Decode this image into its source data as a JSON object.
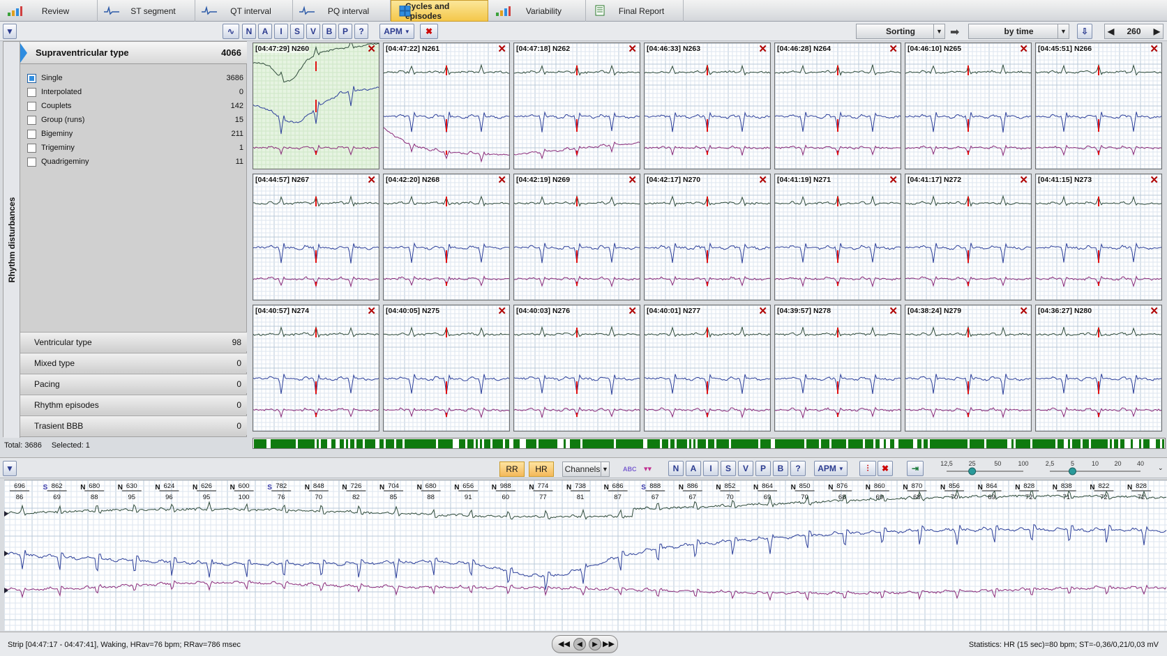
{
  "tabs": [
    {
      "label": "Review",
      "icon": "bar-chart-icon",
      "active": false
    },
    {
      "label": "ST segment",
      "icon": "wave-icon",
      "active": false
    },
    {
      "label": "QT interval",
      "icon": "wave-icon",
      "active": false
    },
    {
      "label": "PQ interval",
      "icon": "wave-icon",
      "active": false
    },
    {
      "label": "Cycles and episodes",
      "icon": "grid-icon",
      "active": true
    },
    {
      "label": "Variability",
      "icon": "bar-chart-icon",
      "active": false
    },
    {
      "label": "Final Report",
      "icon": "document-icon",
      "active": false
    }
  ],
  "toolbar": {
    "class_buttons": [
      "N",
      "A",
      "I",
      "S",
      "V",
      "B",
      "P",
      "?"
    ],
    "apm_label": "APM",
    "sorting_label": "Sorting",
    "by_label": "by time",
    "page_number": "260"
  },
  "left": {
    "vertical_label": "Rhythm disturbances",
    "header": {
      "label": "Supraventricular type",
      "count": "4066"
    },
    "items": [
      {
        "label": "Single",
        "value": "3686",
        "checked": true
      },
      {
        "label": "Interpolated",
        "value": "0",
        "checked": false
      },
      {
        "label": "Couplets",
        "value": "142",
        "checked": false
      },
      {
        "label": "Group (runs)",
        "value": "15",
        "checked": false
      },
      {
        "label": "Bigeminy",
        "value": "211",
        "checked": false
      },
      {
        "label": "Trigeminy",
        "value": "1",
        "checked": false
      },
      {
        "label": "Quadrigeminy",
        "value": "11",
        "checked": false
      }
    ],
    "groups": [
      {
        "label": "Ventricular type",
        "value": "98"
      },
      {
        "label": "Mixed type",
        "value": "0"
      },
      {
        "label": "Pacing",
        "value": "0"
      },
      {
        "label": "Rhythm episodes",
        "value": "0"
      },
      {
        "label": "Trasient BBB",
        "value": "0"
      }
    ],
    "total_label": "Total: 3686",
    "selected_label": "Selected: 1"
  },
  "cycles": [
    {
      "label": "[04:47:29] N260",
      "selected": true
    },
    {
      "label": "[04:47:22] N261"
    },
    {
      "label": "[04:47:18] N262"
    },
    {
      "label": "[04:46:33] N263"
    },
    {
      "label": "[04:46:28] N264"
    },
    {
      "label": "[04:46:10] N265"
    },
    {
      "label": "[04:45:51] N266"
    },
    {
      "label": "[04:44:57] N267"
    },
    {
      "label": "[04:42:20] N268"
    },
    {
      "label": "[04:42:19] N269"
    },
    {
      "label": "[04:42:17] N270"
    },
    {
      "label": "[04:41:19] N271"
    },
    {
      "label": "[04:41:17] N272"
    },
    {
      "label": "[04:41:15] N273"
    },
    {
      "label": "[04:40:57] N274"
    },
    {
      "label": "[04:40:05] N275"
    },
    {
      "label": "[04:40:03] N276"
    },
    {
      "label": "[04:40:01] N277"
    },
    {
      "label": "[04:39:57] N278"
    },
    {
      "label": "[04:38:24] N279"
    },
    {
      "label": "[04:36:27] N280"
    }
  ],
  "close_glyph": "✕",
  "strip_toolbar": {
    "rr_label": "RR",
    "hr_label": "HR",
    "channels_label": "Channels",
    "abc_label": "ABC",
    "class_buttons": [
      "N",
      "A",
      "I",
      "S",
      "V",
      "P",
      "B",
      "?"
    ],
    "apm_label": "APM",
    "speed_ticks": [
      "12,5",
      "25",
      "50",
      "100"
    ],
    "speed_value": 25,
    "gain_ticks": [
      "2,5",
      "5",
      "10",
      "20",
      "40"
    ],
    "gain_value": 5
  },
  "beats": [
    {
      "type": "",
      "rr": "696",
      "hr": "86"
    },
    {
      "type": "S",
      "rr": "862",
      "hr": "69"
    },
    {
      "type": "N",
      "rr": "680",
      "hr": "88"
    },
    {
      "type": "N",
      "rr": "630",
      "hr": "95"
    },
    {
      "type": "N",
      "rr": "624",
      "hr": "96"
    },
    {
      "type": "N",
      "rr": "626",
      "hr": "95"
    },
    {
      "type": "N",
      "rr": "600",
      "hr": "100"
    },
    {
      "type": "S",
      "rr": "782",
      "hr": "76"
    },
    {
      "type": "N",
      "rr": "848",
      "hr": "70"
    },
    {
      "type": "N",
      "rr": "726",
      "hr": "82"
    },
    {
      "type": "N",
      "rr": "704",
      "hr": "85"
    },
    {
      "type": "N",
      "rr": "680",
      "hr": "88"
    },
    {
      "type": "N",
      "rr": "656",
      "hr": "91"
    },
    {
      "type": "N",
      "rr": "988",
      "hr": "60"
    },
    {
      "type": "N",
      "rr": "774",
      "hr": "77"
    },
    {
      "type": "N",
      "rr": "738",
      "hr": "81"
    },
    {
      "type": "N",
      "rr": "686",
      "hr": "87"
    },
    {
      "type": "S",
      "rr": "888",
      "hr": "67"
    },
    {
      "type": "N",
      "rr": "886",
      "hr": "67"
    },
    {
      "type": "N",
      "rr": "852",
      "hr": "70"
    },
    {
      "type": "N",
      "rr": "864",
      "hr": "69"
    },
    {
      "type": "N",
      "rr": "850",
      "hr": "70"
    },
    {
      "type": "N",
      "rr": "876",
      "hr": "68"
    },
    {
      "type": "N",
      "rr": "860",
      "hr": "69"
    },
    {
      "type": "N",
      "rr": "870",
      "hr": "68"
    },
    {
      "type": "N",
      "rr": "856",
      "hr": "70"
    },
    {
      "type": "N",
      "rr": "864",
      "hr": "69"
    },
    {
      "type": "N",
      "rr": "828",
      "hr": "72"
    },
    {
      "type": "N",
      "rr": "838",
      "hr": "71"
    },
    {
      "type": "N",
      "rr": "822",
      "hr": "72"
    },
    {
      "type": "N",
      "rr": "828",
      "hr": "72"
    }
  ],
  "status": {
    "strip_text": "Strip [04:47:17 - 04:47:41], Waking,  HRav=76 bpm; RRav=786 msec",
    "stats_text": "Statistics: HR (15 sec)=80 bpm; ST=-0,36/0,21/0,03 mV"
  },
  "colors": {
    "lead1": "#2e4a3a",
    "lead2": "#2c3f9a",
    "lead3": "#8a2a7a",
    "marker": "#e01010",
    "accent": "#2f8de0",
    "overview": "#0f7a0f"
  }
}
